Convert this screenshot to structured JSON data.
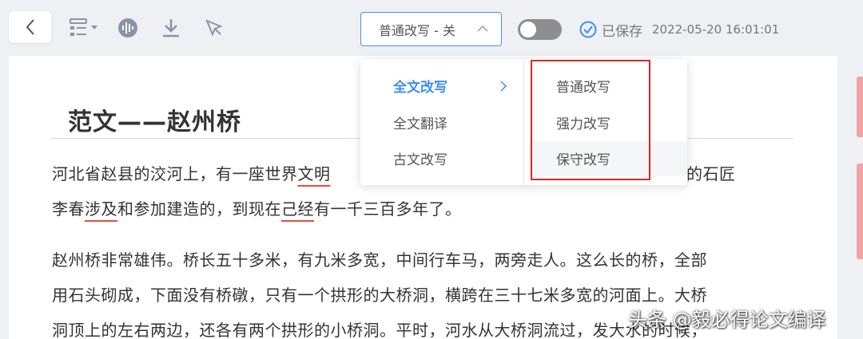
{
  "toolbar": {
    "mode_select_label": "普通改写 - 关",
    "saved_label": "已保存",
    "saved_time": "2022-05-20 16:01:01",
    "toggle_state": "off"
  },
  "dropdown": {
    "categories": [
      "全文改写",
      "全文翻译",
      "古文改写"
    ],
    "active_category": "全文改写",
    "options": [
      "普通改写",
      "强力改写",
      "保守改写"
    ],
    "hovered_option": "保守改写"
  },
  "document": {
    "title": "范文——赵州桥",
    "para1_line1_a": "河北省赵县的洨河上，有一座世界",
    "para1_line1_b": "文明",
    "para1_line1_c": "是隋朝的石匠",
    "para1_line2_a": "李春",
    "para1_line2_b": "涉及",
    "para1_line2_c": "和参加建造的，到现在",
    "para1_line2_d": "己经",
    "para1_line2_e": "有一千三百多年了。",
    "para2_line1": "赵州桥非常雄伟。桥长五十多米，有九米多宽，中间行车马，两旁走人。这么长的桥，全部",
    "para2_line2": "用石头砌成，下面没有桥礅，只有一个拱形的大桥洞，横跨在三十七米多宽的河面上。大桥",
    "para2_line3": "洞顶上的左右两边，还各有两个拱形的小桥洞。平时，河水从大桥洞流过，发大水的时候，"
  },
  "watermark": "头条 @毅必得论文编译",
  "colors": {
    "accent": "#3d8ef0",
    "error_underline": "#e74c3c",
    "highlight_box": "#e02424"
  }
}
